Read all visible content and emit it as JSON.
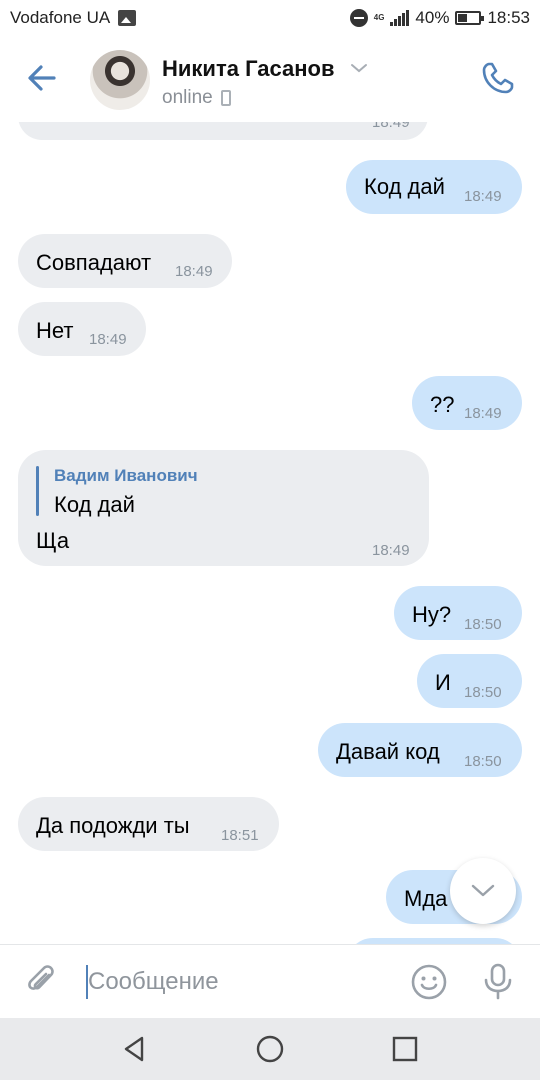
{
  "status_bar": {
    "carrier": "Vodafone UA",
    "network": "4G",
    "battery": "40%",
    "time": "18:53"
  },
  "header": {
    "contact_name": "Никита Гасанов",
    "status": "online"
  },
  "messages": [
    {
      "dir": "in",
      "text": "",
      "time": "18:49"
    },
    {
      "dir": "out",
      "text": "Код дай",
      "time": "18:49"
    },
    {
      "dir": "in",
      "text": "Совпадают",
      "time": "18:49"
    },
    {
      "dir": "in",
      "text": "Нет",
      "time": "18:49"
    },
    {
      "dir": "out",
      "text": "??",
      "time": "18:49"
    },
    {
      "dir": "in",
      "text": "Ща",
      "time": "18:49",
      "reply": {
        "author": "Вадим Иванович",
        "text": "Код дай"
      }
    },
    {
      "dir": "out",
      "text": "Ну?",
      "time": "18:50"
    },
    {
      "dir": "out",
      "text": "И",
      "time": "18:50"
    },
    {
      "dir": "out",
      "text": "Давай код",
      "time": "18:50"
    },
    {
      "dir": "in",
      "text": "Да подожди ты",
      "time": "18:51"
    },
    {
      "dir": "out",
      "text": "Мда",
      "time": ""
    }
  ],
  "composer": {
    "placeholder": "Сообщение"
  },
  "colors": {
    "accent": "#5181b8",
    "incoming_bubble": "#ebedf0",
    "outgoing_bubble": "#cce4fb"
  },
  "icons": [
    "back-arrow-icon",
    "chevron-down-icon",
    "phone-call-icon",
    "paperclip-icon",
    "emoji-icon",
    "microphone-icon",
    "nav-back-icon",
    "nav-home-icon",
    "nav-recents-icon"
  ]
}
